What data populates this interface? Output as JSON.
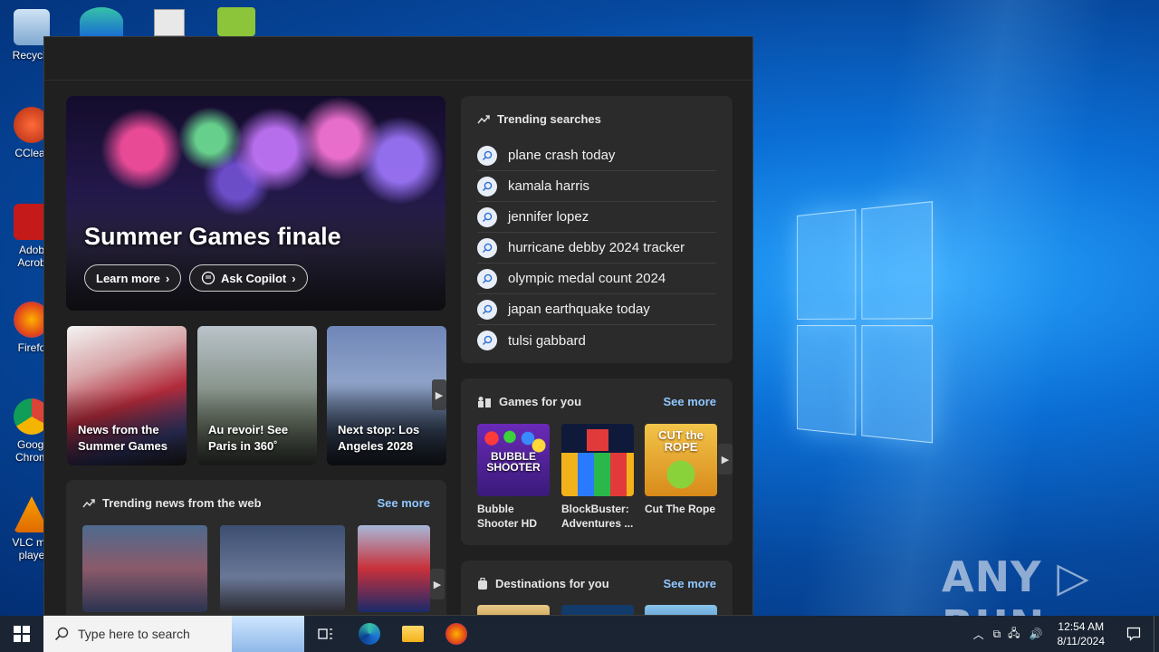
{
  "desktop": {
    "icons": [
      {
        "label": "Recycle",
        "color": "#9fc4e8"
      },
      {
        "label": "CClear",
        "color": "#d94a2a"
      },
      {
        "label": "Adob Acrob",
        "color": "#c41a1a"
      },
      {
        "label": "Firefo",
        "color": "#ff7a1a"
      },
      {
        "label": "Googl Chrom",
        "color": "#e0e0e0"
      },
      {
        "label": "VLC me playe",
        "color": "#f08a00"
      }
    ],
    "watermark": "ANY ▷ RUN"
  },
  "widgets": {
    "hero": {
      "title": "Summer Games finale",
      "learn_more": "Learn more",
      "ask_copilot": "Ask Copilot"
    },
    "news_cards": [
      {
        "caption": "News from the Summer Games"
      },
      {
        "caption": "Au revoir! See Paris in 360˚"
      },
      {
        "caption": "Next stop: Los Angeles 2028"
      }
    ],
    "trending_searches": {
      "title": "Trending searches",
      "items": [
        "plane crash today",
        "kamala harris",
        "jennifer lopez",
        "hurricane debby 2024 tracker",
        "olympic medal count 2024",
        "japan earthquake today",
        "tulsi gabbard"
      ]
    },
    "games": {
      "title": "Games for you",
      "see_more": "See more",
      "items": [
        {
          "name": "Bubble Shooter HD",
          "thumb_text": "BUBBLE SHOOTER"
        },
        {
          "name": "BlockBuster: Adventures ...",
          "thumb_text": ""
        },
        {
          "name": "Cut The Rope",
          "thumb_text": "CUT the ROPE"
        }
      ]
    },
    "trending_news": {
      "title": "Trending news from the web",
      "see_more": "See more"
    },
    "destinations": {
      "title": "Destinations for you",
      "see_more": "See more"
    }
  },
  "taskbar": {
    "search_placeholder": "Type here to search",
    "time": "12:54 AM",
    "date": "8/11/2024"
  },
  "colors": {
    "panel_bg": "#202020",
    "card_bg": "#2b2b2b",
    "link": "#8fc7ff",
    "taskbar": "#1a2433"
  }
}
